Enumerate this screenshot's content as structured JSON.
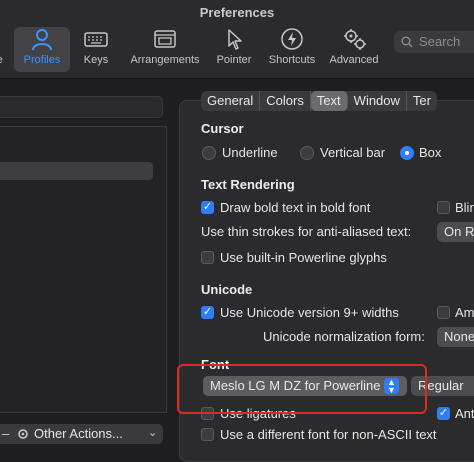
{
  "window": {
    "title": "Preferences"
  },
  "toolbar": {
    "items": [
      {
        "label": "ce",
        "icon": "person-icon"
      },
      {
        "label": "Profiles",
        "icon": "person-icon"
      },
      {
        "label": "Keys",
        "icon": "keyboard-icon"
      },
      {
        "label": "Arrangements",
        "icon": "window-icon"
      },
      {
        "label": "Pointer",
        "icon": "pointer-icon"
      },
      {
        "label": "Shortcuts",
        "icon": "bolt-icon"
      },
      {
        "label": "Advanced",
        "icon": "gears-icon"
      }
    ],
    "search_placeholder": "Search"
  },
  "left": {
    "other_actions_label": "Other Actions..."
  },
  "tabs": [
    "General",
    "Colors",
    "Text",
    "Window",
    "Ter"
  ],
  "cursor": {
    "heading": "Cursor",
    "options": [
      "Underline",
      "Vertical bar",
      "Box"
    ],
    "selected": "Box"
  },
  "text_rendering": {
    "heading": "Text Rendering",
    "bold_label": "Draw bold text in bold font",
    "bold_checked": true,
    "blink_label": "Blin",
    "thin_label": "Use thin strokes for anti-aliased text:",
    "thin_value": "On R",
    "powerline_label": "Use built-in Powerline glyphs"
  },
  "unicode": {
    "heading": "Unicode",
    "version_label": "Use Unicode version 9+ widths",
    "version_checked": true,
    "ambiguous_label": "Am",
    "normalization_label": "Unicode normalization form:",
    "normalization_value": "None"
  },
  "font": {
    "heading": "Font",
    "family": "Meslo LG M DZ for Powerline",
    "style": "Regular",
    "ligatures_label": "Use ligatures",
    "anti_label": "Ant",
    "nonascii_label": "Use a different font for non-ASCII text"
  },
  "colors": {
    "accent": "#2f7ef6",
    "highlight": "#e0281d"
  }
}
